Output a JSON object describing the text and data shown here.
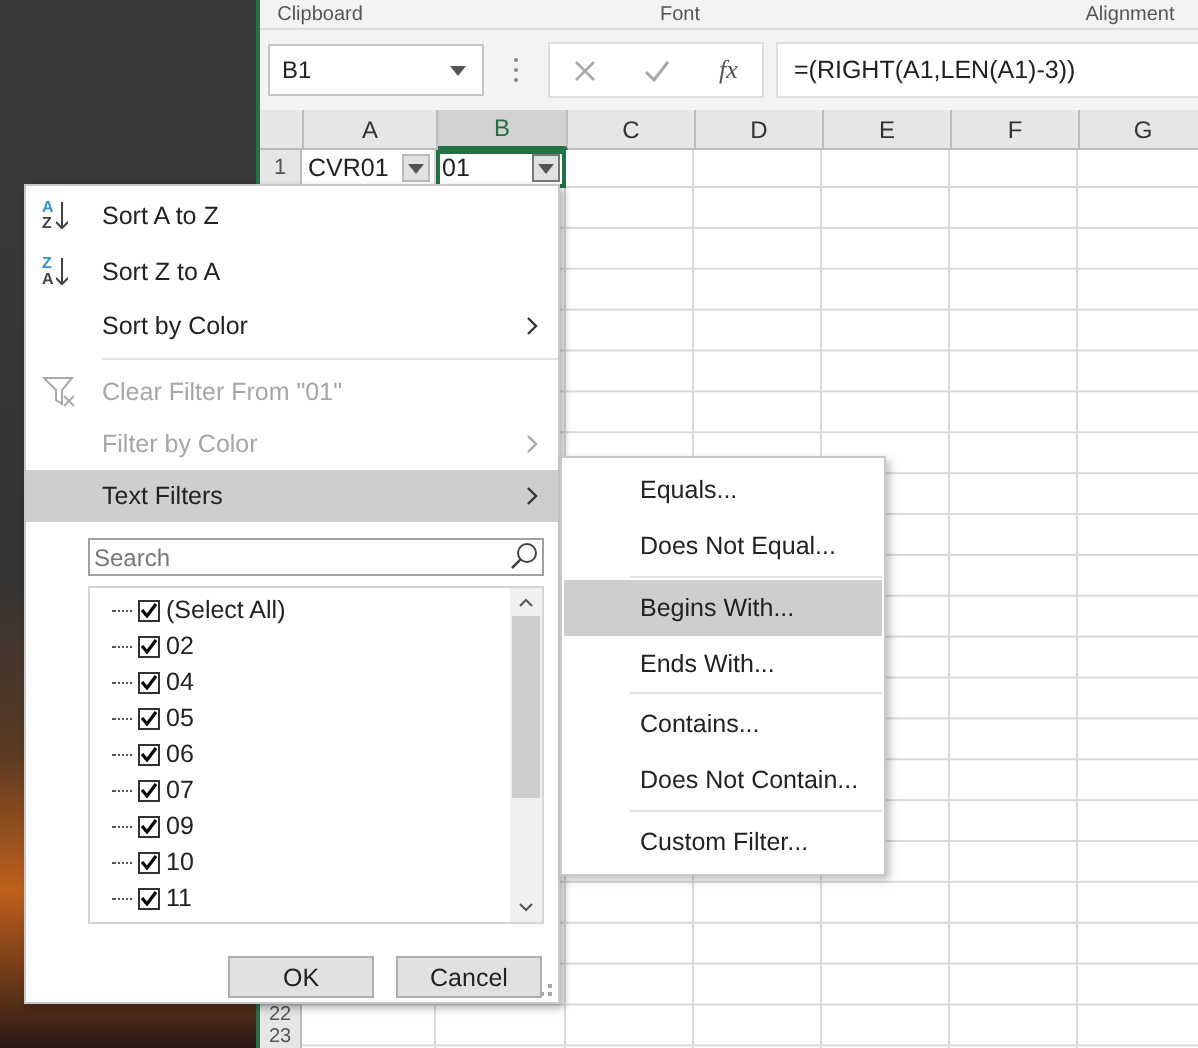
{
  "ribbon_groups": [
    "Clipboard",
    "Font",
    "Alignment"
  ],
  "name_box": "B1",
  "function_label": "fx",
  "formula": "=(RIGHT(A1,LEN(A1)-3))",
  "columns": [
    {
      "label": "A",
      "selected": false
    },
    {
      "label": "B",
      "selected": true
    },
    {
      "label": "C",
      "selected": false
    },
    {
      "label": "D",
      "selected": false
    },
    {
      "label": "E",
      "selected": false
    },
    {
      "label": "F",
      "selected": false
    },
    {
      "label": "G",
      "selected": false
    }
  ],
  "rows": [
    {
      "number": "1",
      "cells": [
        {
          "value": "CVR01",
          "filter": true,
          "selected": false
        },
        {
          "value": "01",
          "filter": true,
          "selected": true
        }
      ]
    },
    {
      "number": "22"
    },
    {
      "number": "23"
    }
  ],
  "filter_menu": {
    "items": [
      {
        "kind": "sort",
        "icon_letters": [
          "A",
          "Z"
        ],
        "label": "Sort A to Z",
        "disabled": false,
        "selected": false
      },
      {
        "kind": "sort",
        "icon_letters": [
          "Z",
          "A"
        ],
        "label": "Sort Z to A",
        "disabled": false,
        "selected": false
      },
      {
        "kind": "submenu",
        "label": "Sort by Color",
        "disabled": false,
        "selected": false
      },
      {
        "kind": "separator"
      },
      {
        "kind": "clear",
        "label": "Clear Filter From \"01\"",
        "disabled": true,
        "selected": false
      },
      {
        "kind": "submenu",
        "label": "Filter by Color",
        "disabled": true,
        "selected": false
      },
      {
        "kind": "submenu",
        "label": "Text Filters",
        "disabled": false,
        "selected": true
      }
    ],
    "search": {
      "placeholder": "Search"
    },
    "values": [
      {
        "label": "(Select All)",
        "checked": true
      },
      {
        "label": "02",
        "checked": true
      },
      {
        "label": "04",
        "checked": true
      },
      {
        "label": "05",
        "checked": true
      },
      {
        "label": "06",
        "checked": true
      },
      {
        "label": "07",
        "checked": true
      },
      {
        "label": "09",
        "checked": true
      },
      {
        "label": "10",
        "checked": true
      },
      {
        "label": "11",
        "checked": true
      }
    ],
    "buttons": [
      "OK",
      "Cancel"
    ]
  },
  "text_filters_menu": [
    {
      "kind": "item",
      "label": "Equals...",
      "selected": false
    },
    {
      "kind": "item",
      "label": "Does Not Equal...",
      "selected": false
    },
    {
      "kind": "separator"
    },
    {
      "kind": "item",
      "label": "Begins With...",
      "selected": true
    },
    {
      "kind": "item",
      "label": "Ends With...",
      "selected": false
    },
    {
      "kind": "separator"
    },
    {
      "kind": "item",
      "label": "Contains...",
      "selected": false
    },
    {
      "kind": "item",
      "label": "Does Not Contain...",
      "selected": false
    },
    {
      "kind": "separator"
    },
    {
      "kind": "item",
      "label": "Custom Filter...",
      "selected": false
    }
  ]
}
